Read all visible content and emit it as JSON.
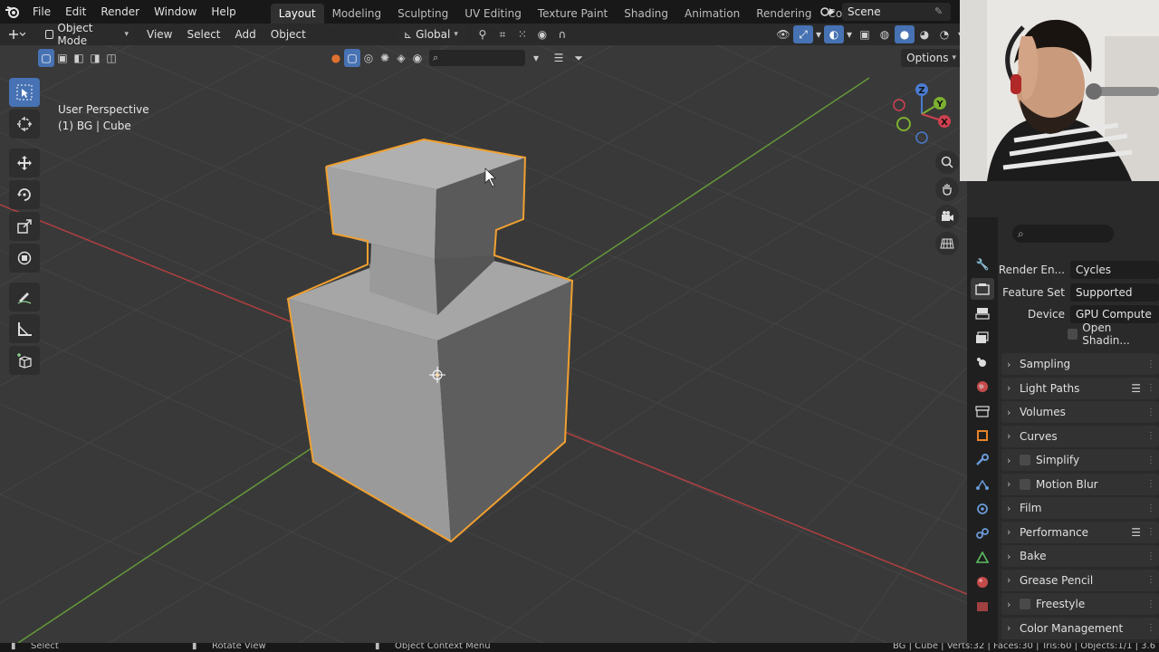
{
  "menu": [
    "File",
    "Edit",
    "Render",
    "Window",
    "Help"
  ],
  "workspaces": [
    {
      "label": "Layout",
      "active": true
    },
    {
      "label": "Modeling",
      "active": false
    },
    {
      "label": "Sculpting",
      "active": false
    },
    {
      "label": "UV Editing",
      "active": false
    },
    {
      "label": "Texture Paint",
      "active": false
    },
    {
      "label": "Shading",
      "active": false
    },
    {
      "label": "Animation",
      "active": false
    },
    {
      "label": "Rendering",
      "active": false
    },
    {
      "label": "Compositing",
      "active": false
    }
  ],
  "scene": {
    "name": "Scene"
  },
  "viewport_header": {
    "mode": "Object Mode",
    "menus": [
      "View",
      "Select",
      "Add",
      "Object"
    ],
    "orientation": "Global",
    "options": "Options"
  },
  "viewport_overlay": {
    "perspective": "User Perspective",
    "object_info": "(1) BG | Cube"
  },
  "gizmo": {
    "z": "Z",
    "y": "Y",
    "x": "X"
  },
  "properties": {
    "rows": [
      {
        "label": "Render En...",
        "value": "Cycles"
      },
      {
        "label": "Feature Set",
        "value": "Supported"
      },
      {
        "label": "Device",
        "value": "GPU Compute"
      }
    ],
    "open_shading": "Open Shadin...",
    "panels": [
      {
        "label": "Sampling",
        "checkbox": false,
        "extra": ""
      },
      {
        "label": "Light Paths",
        "checkbox": false,
        "extra": "list"
      },
      {
        "label": "Volumes",
        "checkbox": false,
        "extra": ""
      },
      {
        "label": "Curves",
        "checkbox": false,
        "extra": ""
      },
      {
        "label": "Simplify",
        "checkbox": true,
        "extra": ""
      },
      {
        "label": "Motion Blur",
        "checkbox": true,
        "extra": ""
      },
      {
        "label": "Film",
        "checkbox": false,
        "extra": ""
      },
      {
        "label": "Performance",
        "checkbox": false,
        "extra": "list"
      },
      {
        "label": "Bake",
        "checkbox": false,
        "extra": ""
      },
      {
        "label": "Grease Pencil",
        "checkbox": false,
        "extra": ""
      },
      {
        "label": "Freestyle",
        "checkbox": true,
        "extra": ""
      },
      {
        "label": "Color Management",
        "checkbox": false,
        "extra": ""
      }
    ]
  },
  "statusbar": {
    "select": "Select",
    "rotate": "Rotate View",
    "context": "Object Context Menu",
    "stats": "BG | Cube | Verts:32 | Faces:30 | Tris:60 | Objects:1/1 | 3.6"
  },
  "colors": {
    "accent": "#4772b3",
    "selection_outline": "#f0a030",
    "x_axis": "#c84545",
    "y_axis": "#6aa030"
  }
}
